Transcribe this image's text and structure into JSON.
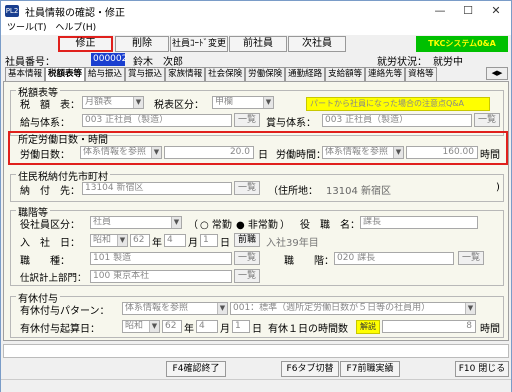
{
  "window": {
    "title": "社員情報の確認・修正",
    "icon_text": "PL2",
    "minimize": "—",
    "maximize": "☐",
    "close": "✕"
  },
  "menu": {
    "tool": "ツール(T)",
    "help": "ヘルプ(H)"
  },
  "toolbar": {
    "modify": "修正",
    "delete": "削除",
    "change_code": "社員ｺｰﾄﾞ変更",
    "prev": "前社員",
    "next": "次社員",
    "brand": "TKCシステム0&A"
  },
  "employee": {
    "label": "社員番号：",
    "number": "000002",
    "name": "鈴木　次郎",
    "status_label": "就労状況：",
    "status_value": "就労中"
  },
  "tabs": [
    "基本情報",
    "税額表等",
    "給与振込",
    "賞与振込",
    "家族情報",
    "社会保険",
    "労働保険",
    "通勤経路",
    "支給額等",
    "連絡先等",
    "資格等"
  ],
  "tax": {
    "title": "税額表等",
    "table_label": "税　額　表：",
    "table_value": "月額表",
    "class_label": "税表区分：",
    "class_value": "甲欄",
    "note": "パートから社員になった場合の注意点Q&A",
    "salary_label": "給与体系：",
    "salary_code": "003",
    "salary_value": "正社員（製造）",
    "salary_btn": "一覧",
    "bonus_label": "賞与体系：",
    "bonus_code": "003",
    "bonus_value": "正社員（製造）",
    "bonus_btn": "一覧"
  },
  "work": {
    "title": "所定労働日数・時間",
    "days_label": "労働日数：",
    "days_src": "体系情報を参照",
    "days_value": "20.0",
    "days_unit": "日",
    "hours_label": "労働時間：",
    "hours_src": "体系情報を参照",
    "hours_value": "160.00",
    "hours_unit": "時間"
  },
  "resident": {
    "title": "住民税納付先市町村",
    "dest_label": "納　付　先：",
    "dest_code": "13104",
    "dest_value": "新宿区",
    "btn": "一覧",
    "addr_label": "（住所地：",
    "addr_code": "13104",
    "addr_value": "新宿区",
    ")": ")"
  },
  "post": {
    "title": "職階等",
    "officer_label": "役社員区分：",
    "officer_value": "社員",
    "paren_open": "（",
    "full_time": "常勤",
    "part_time": "非常勤",
    "paren_close": "）",
    "title_label": "役　職　名：",
    "title_value": "課長",
    "join_label": "入　社　日：",
    "era": "昭和",
    "year": "62",
    "year_unit": "年",
    "month": "4",
    "month_unit": "月",
    "day": "1",
    "day_unit": "日",
    "prev_btn": "前職",
    "join_note": "入社39年目",
    "job_label": "職　　種：",
    "job_code": "101",
    "job_value": "製造",
    "job_btn": "一覧",
    "rank_label": "職　　階：",
    "rank_code": "020",
    "rank_value": "課長",
    "rank_btn": "一覧",
    "dept_label": "仕訳計上部門：",
    "dept_code": "100",
    "dept_value": "東京本社",
    "dept_btn": "一覧"
  },
  "leave": {
    "title": "有休付与",
    "pattern_label": "有休付与パターン：",
    "pattern_src": "体系情報を参照",
    "pattern_value": "001：標準（週所定労働日数が５日等の社員用）",
    "base_label": "有休付与起算日：",
    "era": "昭和",
    "year": "62",
    "year_unit": "年",
    "month": "4",
    "month_unit": "月",
    "day": "1",
    "day_unit": "日",
    "hours_label": "有休１日の時間数",
    "explain": "解説",
    "hours_value": "8",
    "hours_unit": "時間"
  },
  "fkeys": {
    "f4": "F4確認終了",
    "f6": "F6タブ切替",
    "f7": "F7前職実績",
    "f10": "F10 閉じる"
  },
  "colors": {
    "highlight_red": "#e0201c",
    "brand_green": "#00c000",
    "note_yellow": "#ffff00"
  }
}
